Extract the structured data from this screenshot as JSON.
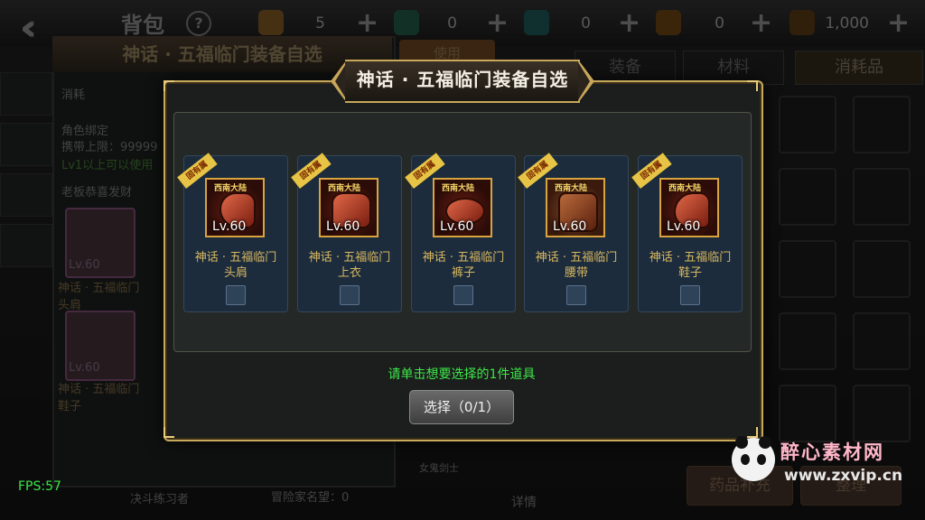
{
  "background": {
    "title": "背包",
    "help": "?",
    "currencies": [
      {
        "name": "gold-coin-icon",
        "value": "5"
      },
      {
        "name": "green-gem-icon",
        "value": "0"
      },
      {
        "name": "teal-gem-icon",
        "value": "0"
      },
      {
        "name": "bread-icon",
        "value": "0"
      },
      {
        "name": "honor-icon",
        "value": "1,000"
      }
    ],
    "tabs": [
      "装备",
      "材料",
      "消耗品"
    ],
    "left_panel": {
      "title": "神话 · 五福临门装备自选",
      "type": "消耗",
      "bind": "角色绑定",
      "carry_limit": "携带上限：99999",
      "level_req": "Lv1以上可以使用",
      "source": "老板恭喜发财",
      "items": [
        {
          "lv": "Lv.60",
          "name": "神话 · 五福临门头肩"
        },
        {
          "lv": "Lv.60",
          "name": "神话 · 五福临门鞋子"
        }
      ]
    },
    "use_button": "使用",
    "npc_name": "女鬼剑士",
    "left_footer": "决斗练习者",
    "adventure_label": "冒险家名望：",
    "adventure_value": "0",
    "detail_label": "详情",
    "btn_a": "药品补充",
    "btn_b": "整理"
  },
  "dialog": {
    "title": "神话 · 五福临门装备自选",
    "items": [
      {
        "badge": "固有属",
        "stamp": "西南大陆",
        "level": "Lv.60",
        "name_line1": "神话 · 五福临门",
        "name_line2": "头肩",
        "checked": false
      },
      {
        "badge": "固有属",
        "stamp": "西南大陆",
        "level": "Lv.60",
        "name_line1": "神话 · 五福临门",
        "name_line2": "上衣",
        "checked": false
      },
      {
        "badge": "固有属",
        "stamp": "西南大陆",
        "level": "Lv.60",
        "name_line1": "神话 · 五福临门",
        "name_line2": "裤子",
        "checked": false
      },
      {
        "badge": "固有属",
        "stamp": "西南大陆",
        "level": "Lv.60",
        "name_line1": "神话 · 五福临门",
        "name_line2": "腰带",
        "checked": false
      },
      {
        "badge": "固有属",
        "stamp": "西南大陆",
        "level": "Lv.60",
        "name_line1": "神话 · 五福临门",
        "name_line2": "鞋子",
        "checked": false
      }
    ],
    "hint": "请单击想要选择的1件道具",
    "select_button": "选择（0/1）"
  },
  "fps": "FPS:57",
  "watermark": {
    "text": "醉心素材网",
    "url": "www.zxvip.cn"
  },
  "colors": {
    "gold": "#c7a95d",
    "hint_green": "#3ee64a",
    "item_name": "#d8b760",
    "card_bg": "#1c2c3d"
  }
}
